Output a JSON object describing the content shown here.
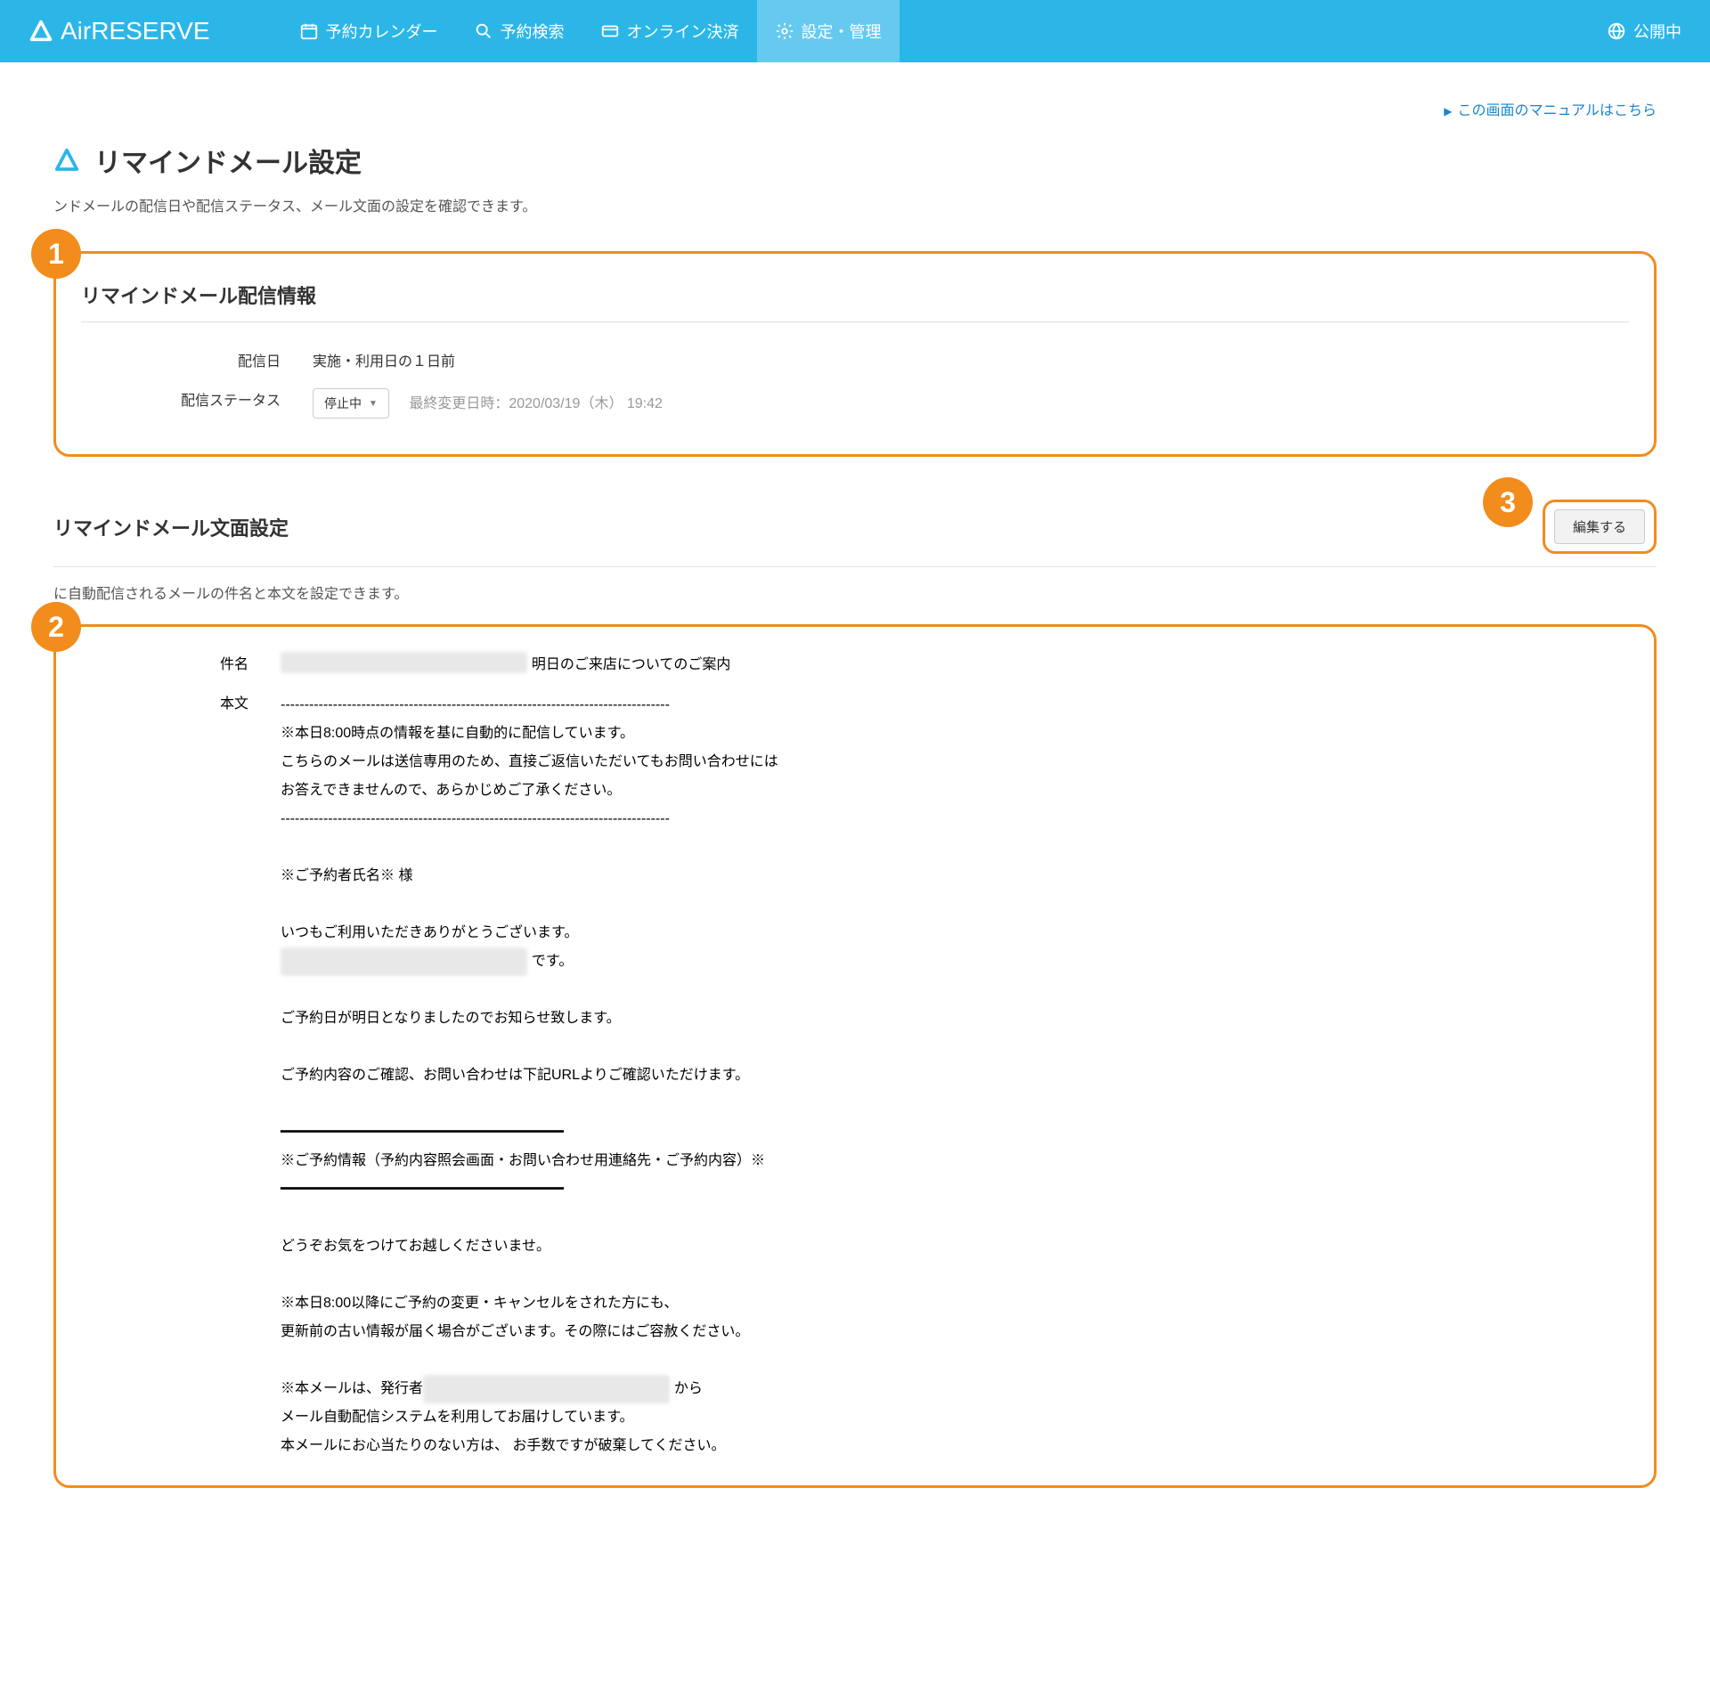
{
  "header": {
    "app_name": "AirRESERVE",
    "nav": [
      {
        "label": "予約カレンダー",
        "icon": "calendar-icon"
      },
      {
        "label": "予約検索",
        "icon": "search-icon"
      },
      {
        "label": "オンライン決済",
        "icon": "card-icon"
      },
      {
        "label": "設定・管理",
        "icon": "gear-icon",
        "active": true
      }
    ],
    "status_label": "公開中"
  },
  "manual_link": "この画面のマニュアルはこちら",
  "page_title": "リマインドメール設定",
  "page_desc": "ンドメールの配信日や配信ステータス、メール文面の設定を確認できます。",
  "section1": {
    "title": "リマインドメール配信情報",
    "delivery_day_label": "配信日",
    "delivery_day_value": "実施・利用日の１日前",
    "status_label": "配信ステータス",
    "status_value": "停止中",
    "last_modified": "最終変更日時：2020/03/19（木） 19:42"
  },
  "section2": {
    "title": "リマインドメール文面設定",
    "edit_button": "編集する",
    "desc": "に自動配信されるメールの件名と本文を設定できます。",
    "subject_label": "件名",
    "subject_blur": "XXXXXXXXXXXXXXX（XXXXXXXX）",
    "subject_suffix": " 明日のご来店についてのご案内",
    "body_label": "本文",
    "body_lines": [
      "----------------------------------------------------------------------------------",
      "※本日8:00時点の情報を基に自動的に配信しています。",
      "こちらのメールは送信専用のため、直接ご返信いただいてもお問い合わせには",
      "お答えできませんので、あらかじめご了承ください。",
      "----------------------------------------------------------------------------------",
      "",
      "※ご予約者氏名※ 様",
      "",
      "いつもご利用いただきありがとうございます。",
      "[[BLUR:XXXXXXXXXXXXXXX（XXXXXXXX）]] です。",
      "",
      "ご予約日が明日となりましたのでお知らせ致します。",
      "",
      "ご予約内容のご確認、お問い合わせは下記URLよりご確認いただけます。",
      "",
      "━━━━━━━━━━━━━━━━━━━━━━━━━━━━━━━━━",
      "※ご予約情報（予約内容照会画面・お問い合わせ用連絡先・ご予約内容）※",
      "━━━━━━━━━━━━━━━━━━━━━━━━━━━━━━━━━",
      "",
      "どうぞお気をつけてお越しくださいませ。",
      "",
      "※本日8:00以降にご予約の変更・キャンセルをされた方にも、",
      "更新前の古い情報が届く場合がございます。その際にはご容赦ください。",
      "",
      "※本メールは、発行者[[BLUR:XXXXXXXXXXXXXXX（XXXXXXXX）]] から",
      "メール自動配信システムを利用してお届けしています。",
      "本メールにお心当たりのない方は、 お手数ですが破棄してください。"
    ]
  },
  "callouts": {
    "c1": "1",
    "c2": "2",
    "c3": "3"
  }
}
